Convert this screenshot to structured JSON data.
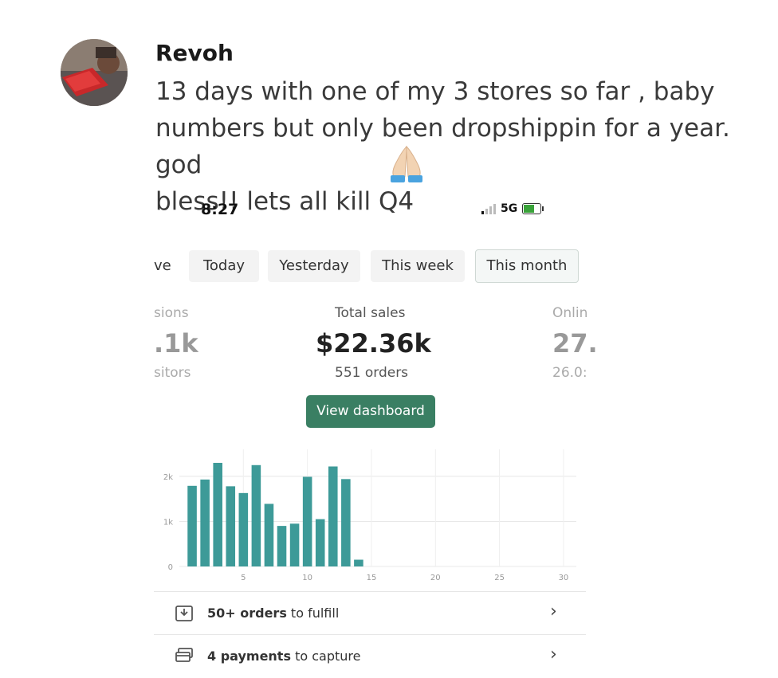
{
  "post": {
    "author": "Revoh",
    "text": "13 days with one of my 3 stores so far , baby\nnumbers but only been dropshippin for a year. god\nbless!! lets all kill Q4",
    "emoji_icon": "folded-hands-icon"
  },
  "status_bar": {
    "time": "8:27",
    "network": "5G"
  },
  "tabs": [
    {
      "label": "ve",
      "active": false
    },
    {
      "label": "Today",
      "active": false
    },
    {
      "label": "Yesterday",
      "active": false
    },
    {
      "label": "This week",
      "active": false
    },
    {
      "label": "This month",
      "active": true
    }
  ],
  "metrics": {
    "left": {
      "label": "sions",
      "value": ".1k",
      "sub": "sitors"
    },
    "center": {
      "label": "Total sales",
      "value": "$22.36k",
      "sub": "551 orders"
    },
    "right": {
      "label": "Onlin",
      "value": "27.",
      "sub": "26.0:"
    }
  },
  "dashboard_button": "View dashboard",
  "chart_data": {
    "type": "bar",
    "x": [
      1,
      2,
      3,
      4,
      5,
      6,
      7,
      8,
      9,
      10,
      11,
      12,
      13,
      14
    ],
    "values": [
      1790,
      1930,
      2300,
      1780,
      1630,
      2250,
      1390,
      900,
      950,
      1990,
      1050,
      2220,
      1940,
      150
    ],
    "xlim": [
      0,
      31
    ],
    "ylim": [
      0,
      2600
    ],
    "y_ticks": [
      "0",
      "1k",
      "2k"
    ],
    "y_tick_values": [
      0,
      1000,
      2000
    ],
    "x_ticks": [
      "5",
      "10",
      "15",
      "20",
      "25",
      "30"
    ],
    "x_tick_values": [
      5,
      10,
      15,
      20,
      25,
      30
    ],
    "bar_color": "#3d9a98",
    "grid": true
  },
  "tasks": [
    {
      "bold": "50+ orders",
      "rest": " to fulfill",
      "icon": "download-box-icon"
    },
    {
      "bold": "4 payments",
      "rest": " to capture",
      "icon": "payment-card-icon"
    }
  ],
  "colors": {
    "accent": "#3a7f63",
    "bar": "#3d9a98"
  }
}
